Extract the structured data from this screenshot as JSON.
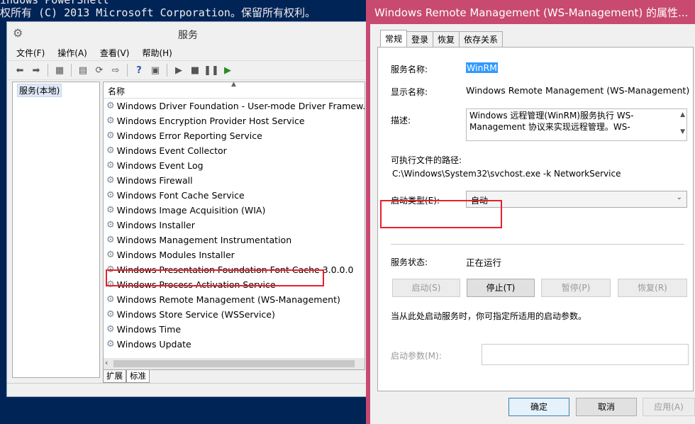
{
  "powershell": {
    "line1": "indows PowerShell",
    "line2": "权所有 (C) 2013 Microsoft Corporation。保留所有权利。"
  },
  "services_window": {
    "title": "服务",
    "menu": [
      "文件(F)",
      "操作(A)",
      "查看(V)",
      "帮助(H)"
    ],
    "tree_root": "服务(本地)",
    "column_header": "名称",
    "services": [
      "Windows Driver Foundation - User-mode Driver Framew...",
      "Windows Encryption Provider Host Service",
      "Windows Error Reporting Service",
      "Windows Event Collector",
      "Windows Event Log",
      "Windows Firewall",
      "Windows Font Cache Service",
      "Windows Image Acquisition (WIA)",
      "Windows Installer",
      "Windows Management Instrumentation",
      "Windows Modules Installer",
      "Windows Presentation Foundation Font Cache 3.0.0.0",
      "Windows Process Activation Service",
      "Windows Remote Management (WS-Management)",
      "Windows Store Service (WSService)",
      "Windows Time",
      "Windows Update"
    ],
    "bottom_tabs": [
      "扩展",
      "标准"
    ]
  },
  "dialog": {
    "title": "Windows Remote Management (WS-Management) 的属性...",
    "tabs": [
      "常规",
      "登录",
      "恢复",
      "依存关系"
    ],
    "service_name_label": "服务名称:",
    "service_name": "WinRM",
    "display_name_label": "显示名称:",
    "display_name": "Windows Remote Management (WS-Management)",
    "description_label": "描述:",
    "description_line1": "Windows 远程管理(WinRM)服务执行 WS-",
    "description_line2": "Management 协议来实现远程管理。WS-",
    "exe_path_label": "可执行文件的路径:",
    "exe_path": "C:\\Windows\\System32\\svchost.exe -k NetworkService",
    "startup_type_label": "启动类型(E):",
    "startup_type": "自动",
    "status_label": "服务状态:",
    "status_value": "正在运行",
    "btn_start": "启动(S)",
    "btn_stop": "停止(T)",
    "btn_pause": "暂停(P)",
    "btn_resume": "恢复(R)",
    "hint": "当从此处启动服务时，你可指定所适用的启动参数。",
    "params_label": "启动参数(M):",
    "btn_ok": "确定",
    "btn_cancel": "取消",
    "btn_apply": "应用(A)"
  },
  "colors": {
    "powershell_bg": "#012456",
    "dialog_title_bg": "#c84a70",
    "highlight_red": "#e8202a",
    "selection_blue": "#3399ff"
  }
}
